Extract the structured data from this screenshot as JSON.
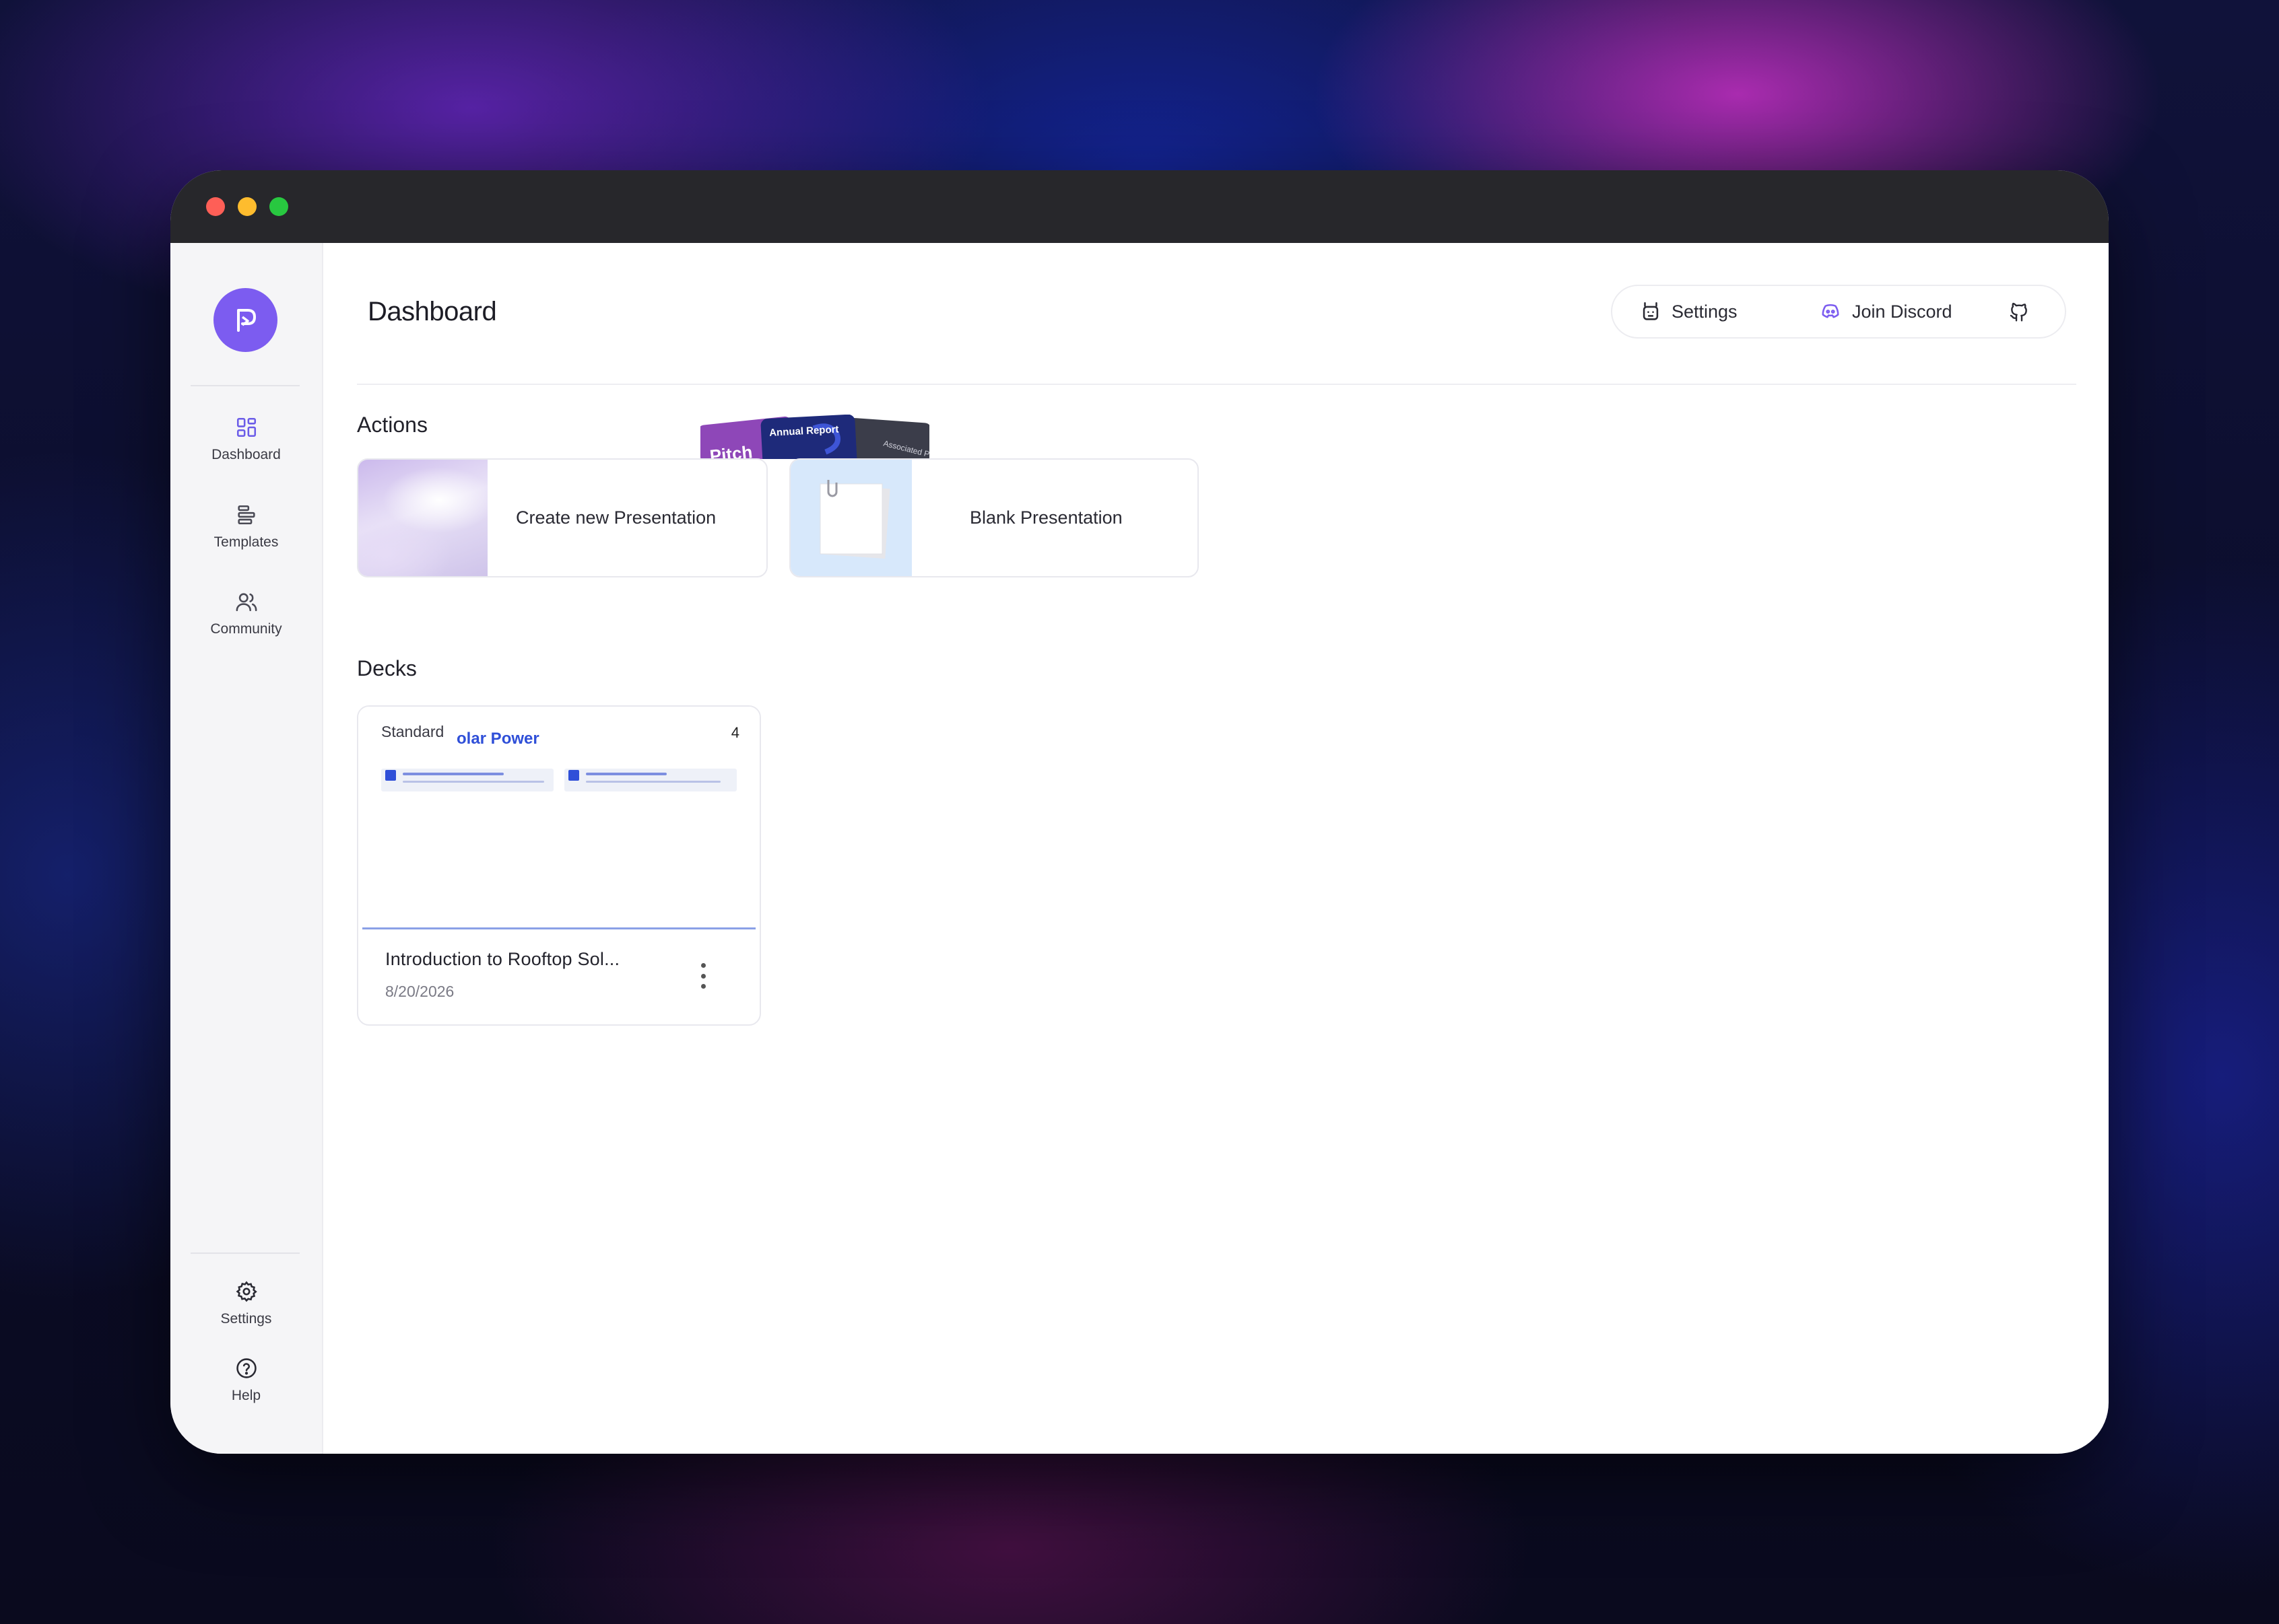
{
  "sidebar": {
    "items": [
      {
        "label": "Dashboard",
        "icon": "grid-icon"
      },
      {
        "label": "Templates",
        "icon": "templates-icon"
      },
      {
        "label": "Community",
        "icon": "users-icon"
      }
    ],
    "bottom_items": [
      {
        "label": "Settings",
        "icon": "gear-icon"
      },
      {
        "label": "Help",
        "icon": "help-circle-icon"
      }
    ]
  },
  "header": {
    "title": "Dashboard",
    "settings_label": "Settings",
    "discord_label": "Join Discord",
    "github_icon": "github-icon"
  },
  "actions": {
    "section_title": "Actions",
    "create_label": "Create new Presentation",
    "blank_label": "Blank Presentation",
    "fan_cards": [
      "Pitch",
      "Annual Report",
      "Associated Project"
    ]
  },
  "decks": {
    "section_title": "Decks",
    "view_modes": [
      "grid",
      "list"
    ],
    "active_view": "grid",
    "items": [
      {
        "badge": "Standard",
        "preview_title": "olar Power",
        "slide_count": "4",
        "name": "Introduction to Rooftop Sol...",
        "date": "8/20/2026"
      }
    ]
  },
  "colors": {
    "accent": "#7c5cf0",
    "preview_blue": "#2f4fd8",
    "titlebar": "#27272b"
  }
}
